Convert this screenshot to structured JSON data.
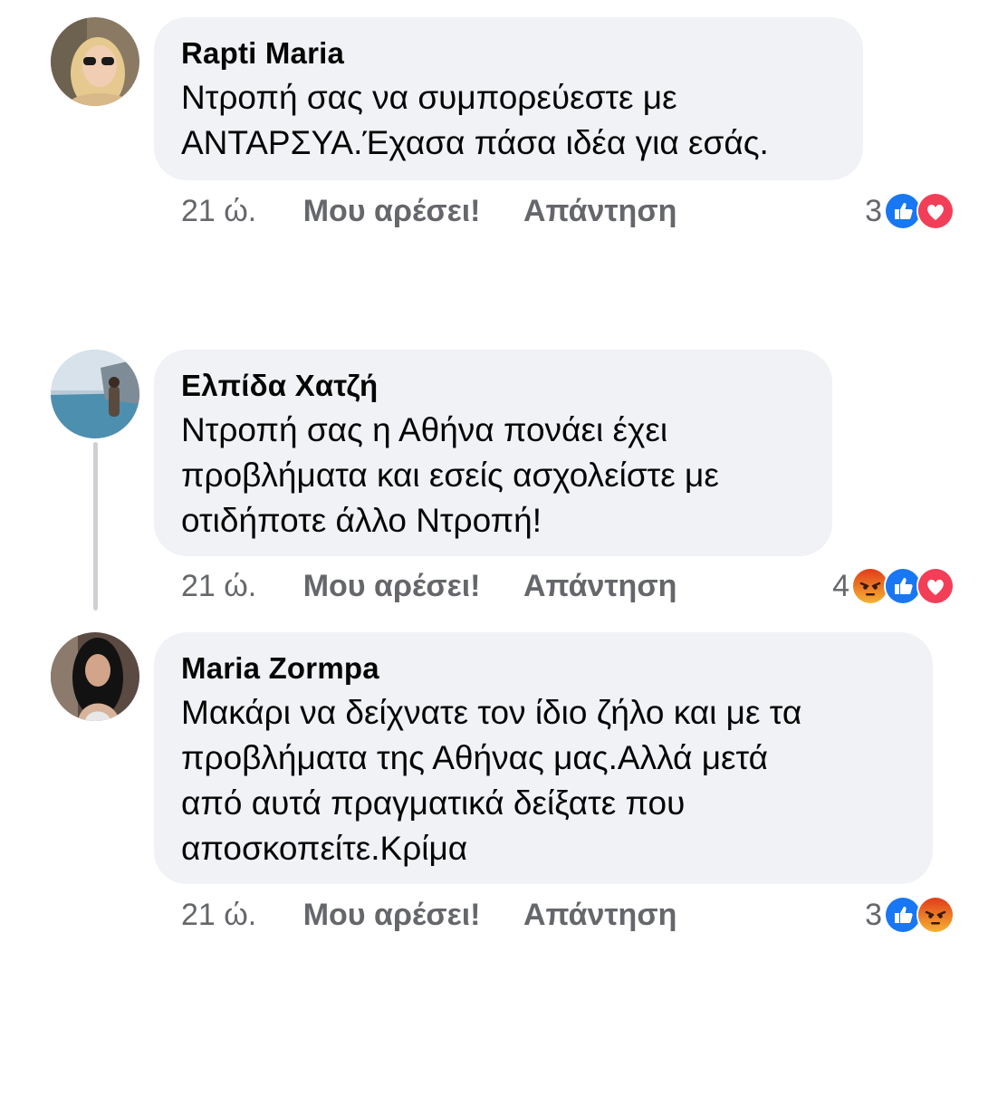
{
  "comments": [
    {
      "author": "Rapti Maria",
      "text_lines": [
        "Ντροπή σας να συμπορεύεστε με",
        "ΑΝΤΑΡΣΥΑ.Έχασα πάσα ιδέα για εσάς."
      ],
      "time": "21 ώ.",
      "like_label": "Μου αρέσει!",
      "reply_label": "Απάντηση",
      "reaction_count": "3",
      "reactions": [
        "like-icon",
        "love-icon"
      ]
    },
    {
      "author": "Ελπίδα Χατζή",
      "text_lines": [
        "Ντροπή σας η Αθήνα πονάει έχει",
        "προβλήματα και εσείς ασχολείστε με",
        "οτιδήποτε άλλο Ντροπή!"
      ],
      "time": "21 ώ.",
      "like_label": "Μου αρέσει!",
      "reply_label": "Απάντηση",
      "reaction_count": "4",
      "reactions": [
        "angry-icon",
        "like-icon",
        "love-icon"
      ]
    },
    {
      "author": "Maria Zormpa",
      "text_lines": [
        "Μακάρι να δείχνατε τον ίδιο ζήλο και με τα",
        "προβλήματα της Αθήνας μας.Αλλά μετά",
        "από αυτά πραγματικά δείξατε που",
        "αποσκοπείτε.Κρίμα"
      ],
      "time": "21 ώ.",
      "like_label": "Μου αρέσει!",
      "reply_label": "Απάντηση",
      "reaction_count": "3",
      "reactions": [
        "like-icon",
        "angry-icon"
      ]
    }
  ],
  "colors": {
    "bubble": "#f0f2f5",
    "meta_text": "#65676b",
    "like_blue": "#1877f2",
    "love_red": "#f33e58",
    "angry_orange": "#e9710f"
  }
}
